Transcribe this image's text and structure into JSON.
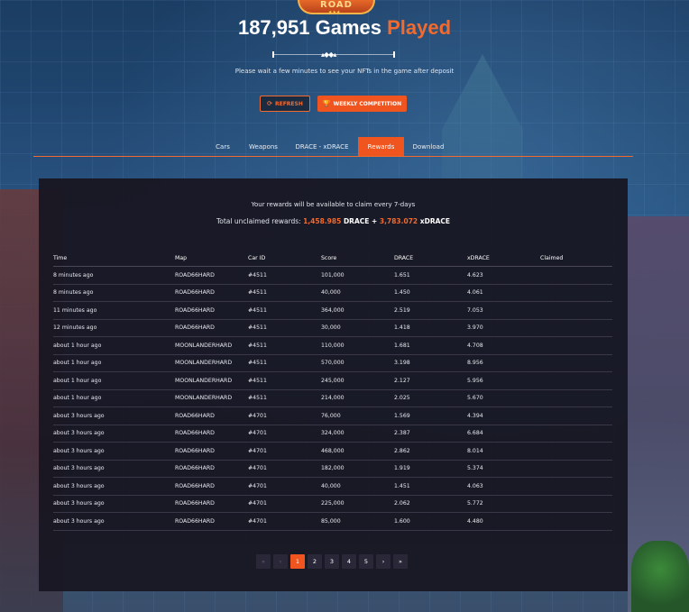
{
  "logo": {
    "text": "ROAD",
    "stars": "★★★"
  },
  "headline": {
    "count": "187,951 Games ",
    "accent": "Played"
  },
  "audio": {
    "wave_glyph": "▴◆◆▴"
  },
  "notice": "Please wait a few minutes to see your NFTs in the game after deposit",
  "buttons": {
    "refresh": {
      "label": "Refresh",
      "icon": "refresh-icon",
      "glyph": "⟳"
    },
    "weekly": {
      "label": "Weekly Competition",
      "icon": "trophy-icon",
      "glyph": "🏆"
    }
  },
  "tabs": [
    {
      "label": "Cars"
    },
    {
      "label": "Weapons"
    },
    {
      "label": "DRACE - xDRACE"
    },
    {
      "label": "Rewards",
      "active": true
    },
    {
      "label": "Download"
    }
  ],
  "rewards": {
    "claim_info": "Your rewards will be available to claim every 7-days",
    "totals_prefix": "Total unclaimed rewards: ",
    "drace_value": "1,458.985",
    "drace_unit": " DRACE",
    "plus": " + ",
    "xdrace_value": "3,783.072",
    "xdrace_unit": " xDRACE"
  },
  "table": {
    "headers": [
      "Time",
      "Map",
      "Car ID",
      "Score",
      "DRACE",
      "xDRACE",
      "Claimed"
    ],
    "rows": [
      [
        "8 minutes ago",
        "ROAD66HARD",
        "#4511",
        "101,000",
        "1.651",
        "4.623",
        ""
      ],
      [
        "8 minutes ago",
        "ROAD66HARD",
        "#4511",
        "40,000",
        "1.450",
        "4.061",
        ""
      ],
      [
        "11 minutes ago",
        "ROAD66HARD",
        "#4511",
        "364,000",
        "2.519",
        "7.053",
        ""
      ],
      [
        "12 minutes ago",
        "ROAD66HARD",
        "#4511",
        "30,000",
        "1.418",
        "3.970",
        ""
      ],
      [
        "about 1 hour ago",
        "MOONLANDERHARD",
        "#4511",
        "110,000",
        "1.681",
        "4.708",
        ""
      ],
      [
        "about 1 hour ago",
        "MOONLANDERHARD",
        "#4511",
        "570,000",
        "3.198",
        "8.956",
        ""
      ],
      [
        "about 1 hour ago",
        "MOONLANDERHARD",
        "#4511",
        "245,000",
        "2.127",
        "5.956",
        ""
      ],
      [
        "about 1 hour ago",
        "MOONLANDERHARD",
        "#4511",
        "214,000",
        "2.025",
        "5.670",
        ""
      ],
      [
        "about 3 hours ago",
        "ROAD66HARD",
        "#4701",
        "76,000",
        "1.569",
        "4.394",
        ""
      ],
      [
        "about 3 hours ago",
        "ROAD66HARD",
        "#4701",
        "324,000",
        "2.387",
        "6.684",
        ""
      ],
      [
        "about 3 hours ago",
        "ROAD66HARD",
        "#4701",
        "468,000",
        "2.862",
        "8.014",
        ""
      ],
      [
        "about 3 hours ago",
        "ROAD66HARD",
        "#4701",
        "182,000",
        "1.919",
        "5.374",
        ""
      ],
      [
        "about 3 hours ago",
        "ROAD66HARD",
        "#4701",
        "40,000",
        "1.451",
        "4.063",
        ""
      ],
      [
        "about 3 hours ago",
        "ROAD66HARD",
        "#4701",
        "225,000",
        "2.062",
        "5.772",
        ""
      ],
      [
        "about 3 hours ago",
        "ROAD66HARD",
        "#4701",
        "85,000",
        "1.600",
        "4.480",
        ""
      ]
    ]
  },
  "pagination": {
    "first": "«",
    "prev": "‹",
    "pages": [
      "1",
      "2",
      "3",
      "4",
      "5"
    ],
    "current": "1",
    "next": "›",
    "last": "»"
  },
  "colors": {
    "accent": "#f0551f",
    "panel": "#18162200"
  }
}
